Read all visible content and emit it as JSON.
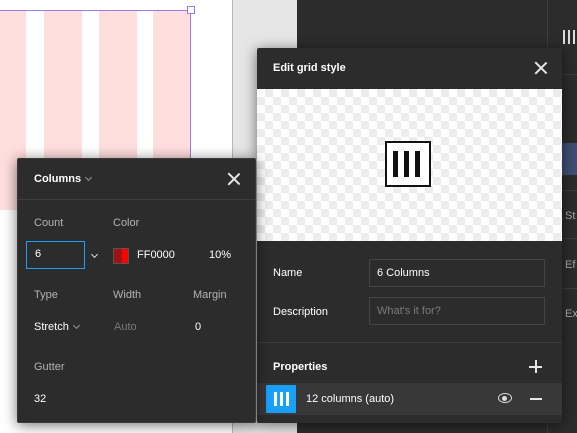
{
  "columns_dialog": {
    "title": "Columns",
    "count_label": "Count",
    "count_value": "6",
    "color_label": "Color",
    "color_hex": "FF0000",
    "color_opacity": "10%",
    "type_label": "Type",
    "type_value": "Stretch",
    "width_label": "Width",
    "width_value": "Auto",
    "margin_label": "Margin",
    "margin_value": "0",
    "gutter_label": "Gutter",
    "gutter_value": "32"
  },
  "edit_dialog": {
    "title": "Edit grid style",
    "name_label": "Name",
    "name_value": "6 Columns",
    "description_label": "Description",
    "description_placeholder": "What's it for?",
    "properties_label": "Properties",
    "grid_row_label": "12 columns (auto)"
  },
  "right_strip": {
    "items": [
      "St",
      "Ef",
      "Ex"
    ]
  },
  "colors": {
    "accent": "#18a0fb",
    "grid_color": "#FF0000",
    "panel_bg": "#2c2c2c",
    "frame_selection": "#9b7be6"
  },
  "icons": [
    "close-icon",
    "chevron-down-icon",
    "grid-columns-icon",
    "plus-icon",
    "eye-icon",
    "minus-icon"
  ]
}
